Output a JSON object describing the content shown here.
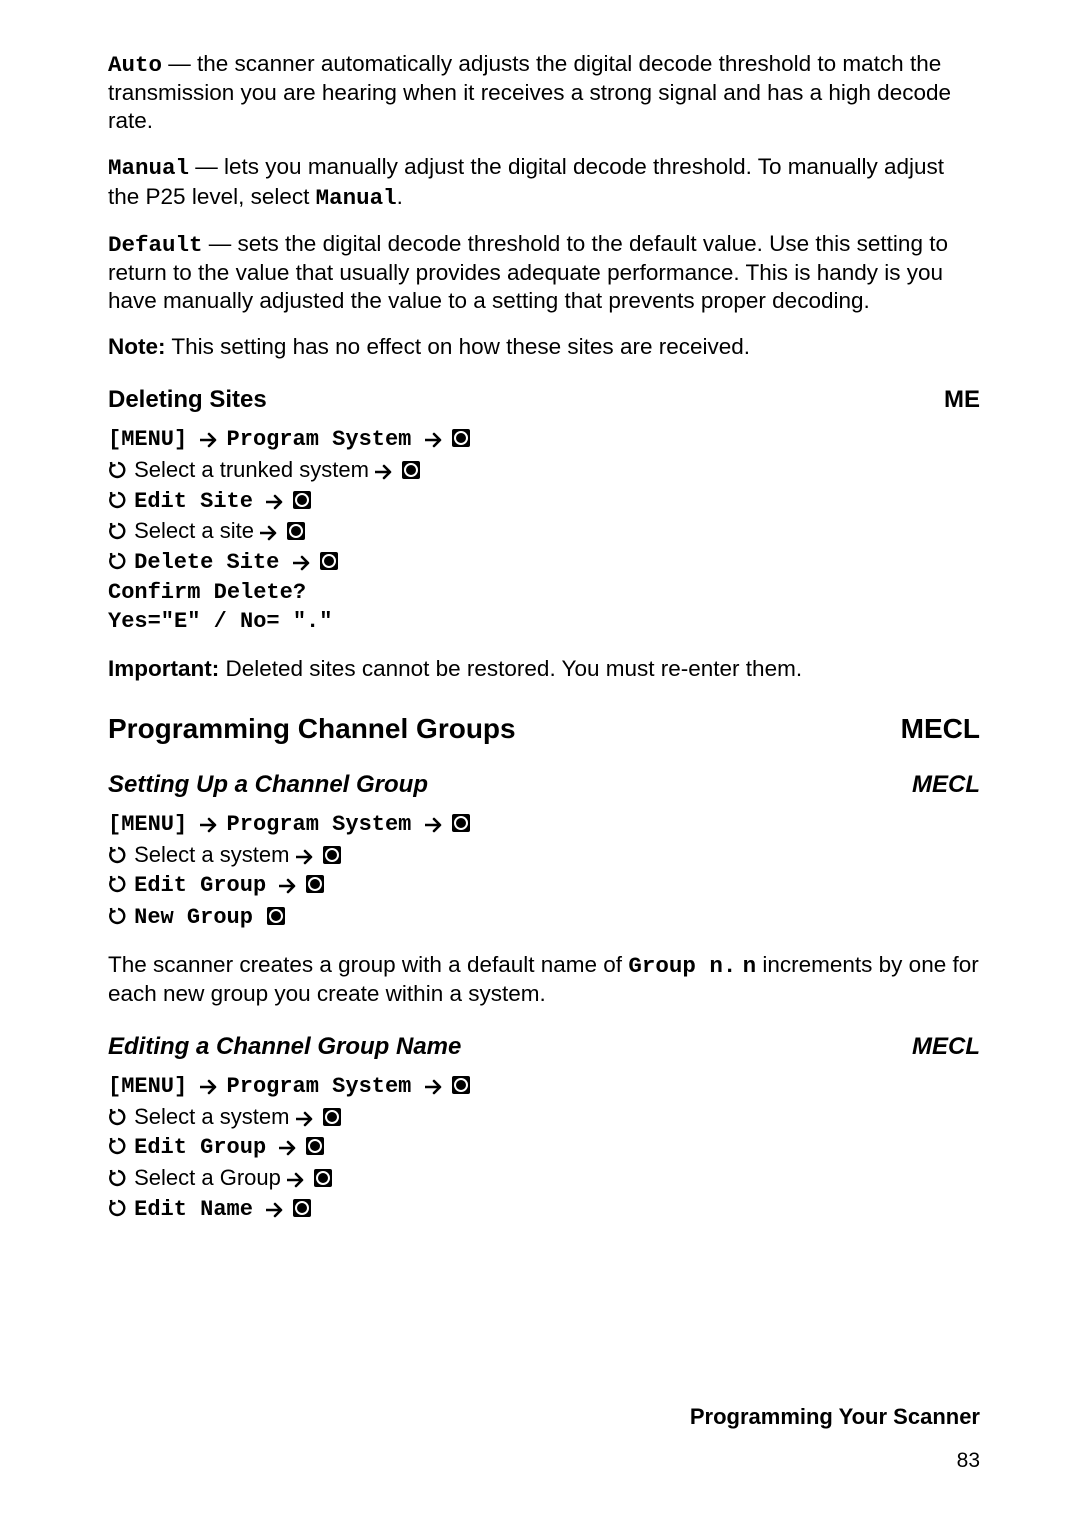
{
  "para_auto": {
    "term": "Auto",
    "dash": " — ",
    "text": "the scanner automatically adjusts the digital decode threshold to match the transmission you are hearing when it receives a strong signal and has a high decode rate."
  },
  "para_manual": {
    "term": "Manual",
    "dash": " — ",
    "text1": "lets you manually adjust the digital decode threshold. To manually adjust the P25 level, select ",
    "term2": "Manual",
    "text2": "."
  },
  "para_default": {
    "term": "Default",
    "dash": " — ",
    "text": "sets the digital decode threshold to the default value. Use this setting to return to the value that usually provides adequate performance. This is handy is you have manually adjusted the value to a setting that prevents proper decoding."
  },
  "note_line": {
    "label": "Note:",
    "text": " This setting has no effect on how these sites are received."
  },
  "sec_deleting": {
    "title": "Deleting Sites",
    "tag": "ME"
  },
  "steps_delete": {
    "l1a": "[MENU] ",
    "l1b": "Program System ",
    "l2a": " Select a trunked system ",
    "l3a": "Edit Site ",
    "l4a": " Select a site ",
    "l5a": "Delete Site ",
    "l6": "Confirm Delete?",
    "l7": "Yes=\"E\" / No= \".\""
  },
  "important_line": {
    "label": "Important:",
    "text": " Deleted sites cannot be restored. You must re-enter them."
  },
  "sec_prog_groups": {
    "title": "Programming Channel Groups",
    "tag": "MECL"
  },
  "sec_setup_group": {
    "title": "Setting Up a Channel Group",
    "tag": "MECL"
  },
  "steps_setup": {
    "l1a": "[MENU] ",
    "l1b": "Program System ",
    "l2a": " Select a system ",
    "l3a": "Edit Group ",
    "l4a": "New Group "
  },
  "para_group_creates": {
    "t1": "The scanner creates a group with a default name of ",
    "m1": "Group n.",
    "t2": " ",
    "m2": "n",
    "t3": " increments by one for each new group you create within a system."
  },
  "sec_edit_group_name": {
    "title": "Editing a Channel Group Name",
    "tag": "MECL"
  },
  "steps_edit_name": {
    "l1a": "[MENU] ",
    "l1b": "Program System ",
    "l2a": " Select a system ",
    "l3a": "Edit Group ",
    "l4a": " Select a Group ",
    "l5a": "Edit Name "
  },
  "footer": {
    "section": "Programming Your Scanner",
    "page": "83"
  }
}
